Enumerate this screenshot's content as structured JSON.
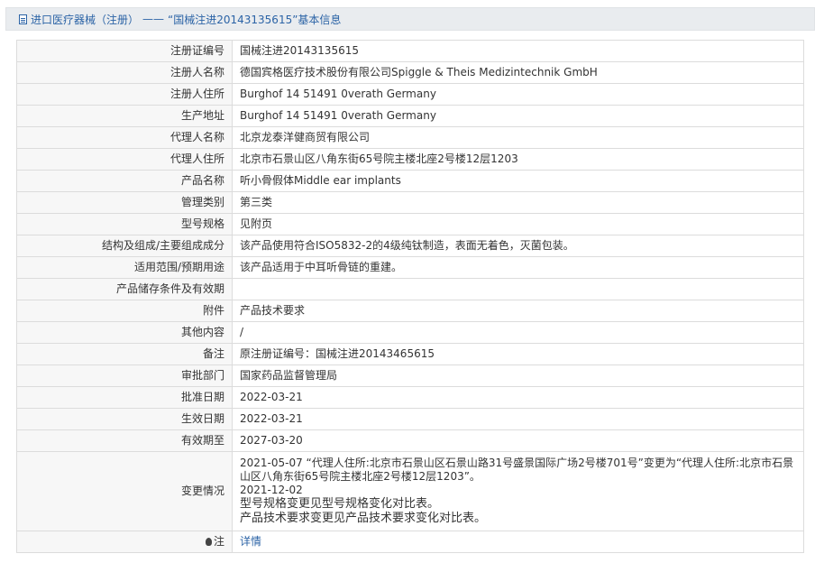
{
  "breadcrumb": {
    "section": "进口医疗器械（注册）",
    "separator": "——",
    "title": "“国械注进20143135615”基本信息"
  },
  "rows": [
    {
      "label": "注册证编号",
      "value": "国械注进20143135615"
    },
    {
      "label": "注册人名称",
      "value": "德国宾格医疗技术股份有限公司Spiggle & Theis Medizintechnik GmbH"
    },
    {
      "label": "注册人住所",
      "value": "Burghof 14 51491 0verath Germany"
    },
    {
      "label": "生产地址",
      "value": "Burghof 14 51491 0verath Germany"
    },
    {
      "label": "代理人名称",
      "value": "北京龙泰洋健商贸有限公司"
    },
    {
      "label": "代理人住所",
      "value": "北京市石景山区八角东街65号院主楼北座2号楼12层1203"
    },
    {
      "label": "产品名称",
      "value": "听小骨假体Middle ear implants"
    },
    {
      "label": "管理类别",
      "value": "第三类"
    },
    {
      "label": "型号规格",
      "value": "见附页"
    },
    {
      "label": "结构及组成/主要组成成分",
      "value": "该产品使用符合ISO5832-2的4级纯钛制造，表面无着色，灭菌包装。"
    },
    {
      "label": "适用范围/预期用途",
      "value": "该产品适用于中耳听骨链的重建。"
    },
    {
      "label": "产品储存条件及有效期",
      "value": ""
    },
    {
      "label": "附件",
      "value": "产品技术要求"
    },
    {
      "label": "其他内容",
      "value": "/"
    },
    {
      "label": "备注",
      "value": "原注册证编号：国械注进20143465615"
    },
    {
      "label": "审批部门",
      "value": "国家药品监督管理局"
    },
    {
      "label": "批准日期",
      "value": "2022-03-21"
    },
    {
      "label": "生效日期",
      "value": "2022-03-21"
    },
    {
      "label": "有效期至",
      "value": "2027-03-20"
    }
  ],
  "changes": {
    "label": "变更情况",
    "line1": "2021-05-07 “代理人住所:北京市石景山区石景山路31号盛景国际广场2号楼701号”变更为“代理人住所:北京市石景山区八角东街65号院主楼北座2号楼12层1203”。",
    "line2": "2021-12-02",
    "line3": "型号规格变更见型号规格变化对比表。",
    "line4": "产品技术要求变更见产品技术要求变化对比表。"
  },
  "note": {
    "label": "注",
    "icon": "bulb-icon",
    "link_text": "详情"
  },
  "colors": {
    "accent": "#2b63a6",
    "label_bg": "#f7f7f7",
    "border": "#dcdcdc"
  }
}
